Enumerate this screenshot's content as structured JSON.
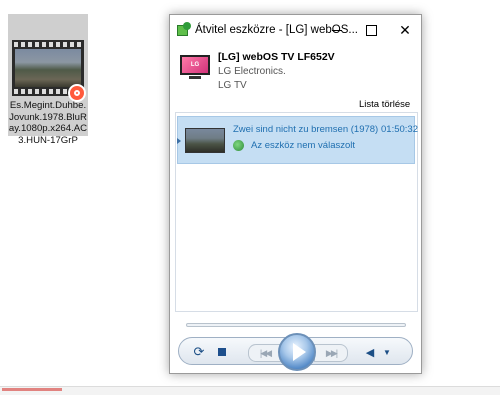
{
  "desktop_file": {
    "label": "Es.Megint.Duhbe.Jovunk.1978.BluRay.1080p.x264.AC3.HUN-17GrP",
    "icon": "video-file-icon",
    "badge_icon": "cast-badge-icon",
    "badge_color": "#ff5a3c"
  },
  "window": {
    "title": "Átvitel eszközre - [LG] webOS...",
    "minimize_glyph": "",
    "maximize_glyph": "",
    "close_glyph": "✕"
  },
  "device": {
    "name": "[LG] webOS TV LF652V",
    "manufacturer": "LG Electronics.",
    "type": "LG TV",
    "logo_text": "LG"
  },
  "clear_list_label": "Lista törlése",
  "playlist": [
    {
      "title": "Zwei sind nicht zu bremsen (1978)",
      "duration": "01:50:32",
      "status": "Az eszköz nem válaszolt"
    }
  ],
  "controls": {
    "repeat_glyph": "⟳",
    "prev_glyph": "|◀◀",
    "next_glyph": "▶▶|",
    "volume_glyph": "◀",
    "dropdown_glyph": "▼"
  },
  "colors": {
    "accent": "#1f6fb0",
    "selection": "#c5def3",
    "play_button": "#3b78be"
  }
}
